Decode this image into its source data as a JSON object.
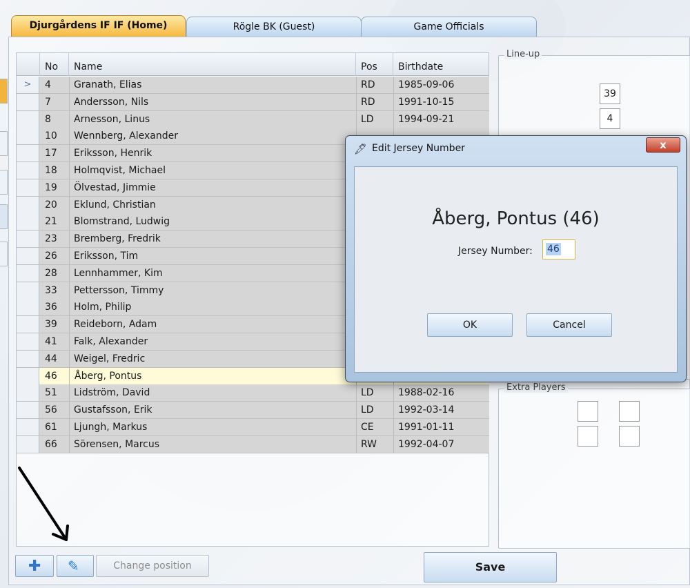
{
  "tabs": [
    {
      "label": "Djurgårdens IF IF (Home)",
      "active": true
    },
    {
      "label": "Rögle BK (Guest)",
      "active": false
    },
    {
      "label": "Game Officials",
      "active": false
    }
  ],
  "grid": {
    "columns": [
      "No",
      "Name",
      "Pos",
      "Birthdate"
    ],
    "current_row_marker": ">",
    "rows": [
      {
        "no": "4",
        "name": "Granath, Elias",
        "pos": "RD",
        "birthdate": "1985-09-06"
      },
      {
        "no": "7",
        "name": "Andersson, Nils",
        "pos": "RD",
        "birthdate": "1991-10-15"
      },
      {
        "no": "8",
        "name": "Arnesson, Linus",
        "pos": "LD",
        "birthdate": "1994-09-21"
      },
      {
        "no": "10",
        "name": "Wennberg, Alexander",
        "pos": "",
        "birthdate": ""
      },
      {
        "no": "17",
        "name": "Eriksson, Henrik",
        "pos": "",
        "birthdate": ""
      },
      {
        "no": "18",
        "name": "Holmqvist, Michael",
        "pos": "",
        "birthdate": ""
      },
      {
        "no": "19",
        "name": "Ölvestad, Jimmie",
        "pos": "",
        "birthdate": ""
      },
      {
        "no": "20",
        "name": "Eklund, Christian",
        "pos": "",
        "birthdate": ""
      },
      {
        "no": "21",
        "name": "Blomstrand, Ludwig",
        "pos": "",
        "birthdate": ""
      },
      {
        "no": "23",
        "name": "Bremberg, Fredrik",
        "pos": "",
        "birthdate": ""
      },
      {
        "no": "26",
        "name": "Eriksson, Tim",
        "pos": "",
        "birthdate": ""
      },
      {
        "no": "28",
        "name": "Lennhammer, Kim",
        "pos": "",
        "birthdate": ""
      },
      {
        "no": "33",
        "name": "Pettersson, Timmy",
        "pos": "",
        "birthdate": ""
      },
      {
        "no": "36",
        "name": "Holm, Philip",
        "pos": "",
        "birthdate": ""
      },
      {
        "no": "39",
        "name": "Reideborn, Adam",
        "pos": "",
        "birthdate": ""
      },
      {
        "no": "41",
        "name": "Falk, Alexander",
        "pos": "",
        "birthdate": ""
      },
      {
        "no": "44",
        "name": "Weigel, Fredric",
        "pos": "",
        "birthdate": ""
      },
      {
        "no": "46",
        "name": "Åberg, Pontus",
        "pos": "",
        "birthdate": "",
        "selected": true
      },
      {
        "no": "51",
        "name": "Lidström, David",
        "pos": "LD",
        "birthdate": "1988-02-16"
      },
      {
        "no": "56",
        "name": "Gustafsson, Erik",
        "pos": "LD",
        "birthdate": "1992-03-14"
      },
      {
        "no": "61",
        "name": "Ljungh, Markus",
        "pos": "CE",
        "birthdate": "1991-01-11"
      },
      {
        "no": "66",
        "name": "Sörensen, Marcus",
        "pos": "RW",
        "birthdate": "1992-04-07"
      }
    ]
  },
  "lineup": {
    "title": "Line-up",
    "slots": [
      "39",
      "4"
    ]
  },
  "extra_players": {
    "title": "Extra Players"
  },
  "toolbar": {
    "add_icon": "plus-icon",
    "edit_icon": "pencil-icon",
    "change_position_label": "Change position",
    "save_label": "Save"
  },
  "dialog": {
    "title": "Edit Jersey Number",
    "close_label": "x",
    "player_heading": "Åberg, Pontus (46)",
    "jersey_label": "Jersey Number:",
    "jersey_value": "46",
    "ok_label": "OK",
    "cancel_label": "Cancel"
  },
  "colors": {
    "active_tab": "#f6b73c",
    "selected_row": "#fffbd9",
    "row_bg": "#d6d6d6"
  }
}
